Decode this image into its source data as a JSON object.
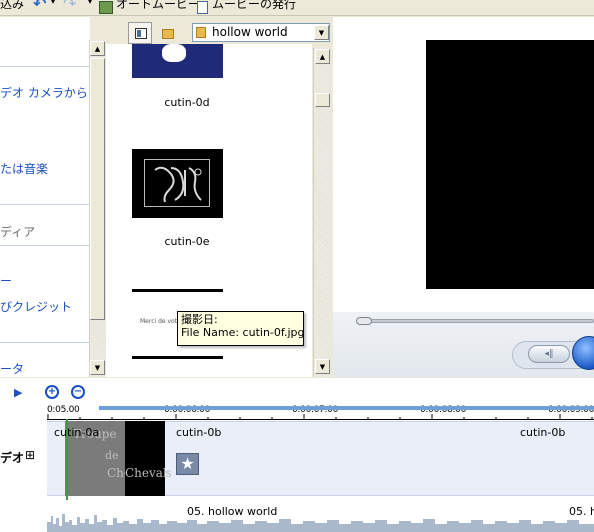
{
  "toolbar": {
    "left_text": "込み",
    "automovie_label": "オートムービー",
    "publish_label": "ムービーの発行"
  },
  "tasks": {
    "items": [
      {
        "label": "デオ カメラから"
      },
      {
        "label": "たは音楽"
      },
      {
        "label": "ディア"
      },
      {
        "label": "ー"
      },
      {
        "label": "びクレジット"
      },
      {
        "label": "ータ"
      }
    ]
  },
  "collection": {
    "selected": "hollow world",
    "items": [
      {
        "caption": "cutin-0d"
      },
      {
        "caption": "cutin-0e"
      },
      {
        "caption": "Merci de votre"
      }
    ]
  },
  "tooltip": {
    "line1": "撮影日:",
    "line2": "File Name: cutin-0f.jpg"
  },
  "timeline": {
    "ticks": [
      "0:05.00",
      "0:00:06.00",
      "0:00:07.00",
      "0:00:08.00",
      "0:00:09.00"
    ],
    "track_label": "デオ",
    "expand_symbol": "⊞",
    "clips": [
      {
        "label": "cutin-0a",
        "image_text": [
          "Troupe",
          "de",
          "Chevaliers"
        ]
      },
      {
        "label": "cutin-0b"
      },
      {
        "label": "cutin-0b"
      }
    ],
    "audio_labels": [
      "05. hollow world",
      "05. h"
    ]
  },
  "colors": {
    "link": "#1b4ec6",
    "toolbar_bg": "#ece9d8",
    "accent_blue": "#2b6bd1",
    "tooltip_bg": "#ffffe1",
    "waveform": "#aab8cc"
  }
}
